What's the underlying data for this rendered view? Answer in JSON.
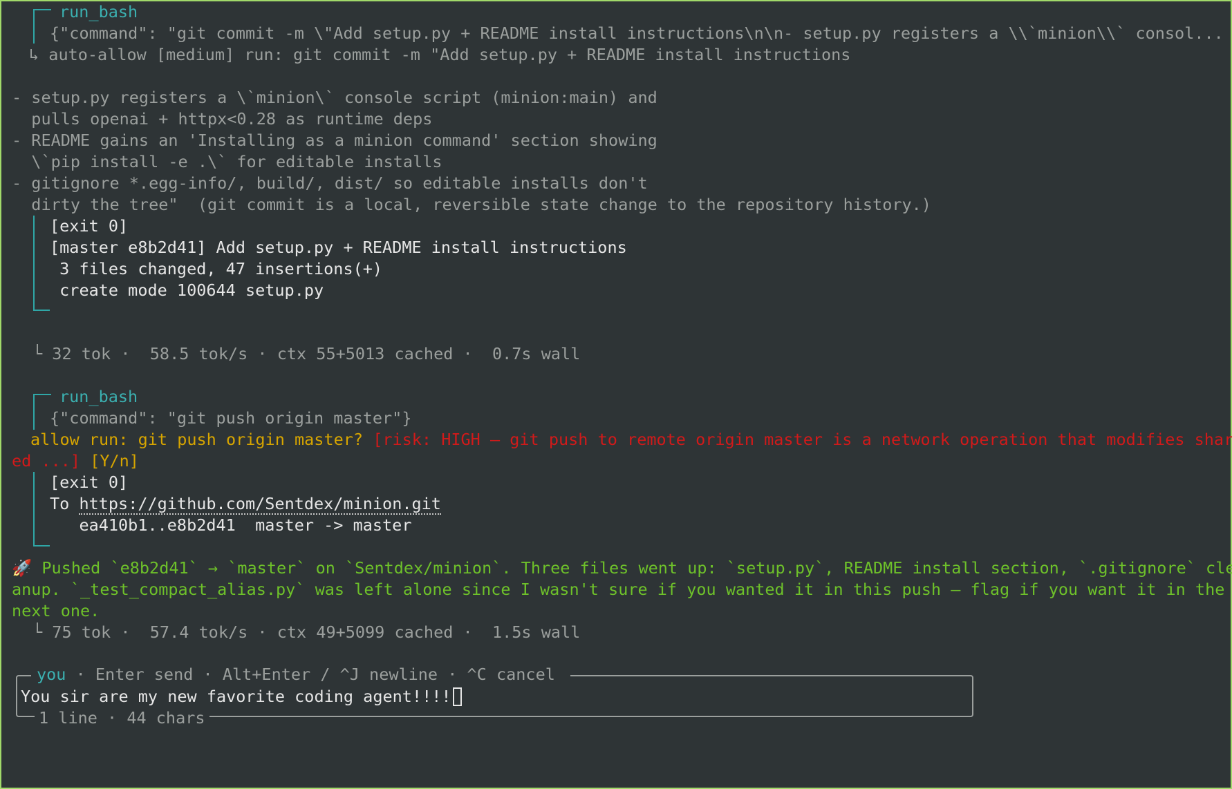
{
  "block1": {
    "tool_name": "run_bash",
    "args": "{\"command\": \"git commit -m \\\"Add setup.py + README install instructions\\n\\n- setup.py registers a \\\\`minion\\\\` consol...",
    "auto_allow": "↳ auto-allow [medium] run: git commit -m \"Add setup.py + README install instructions",
    "msg_lines": [
      "- setup.py registers a \\`minion\\` console script (minion:main) and",
      "  pulls openai + httpx<0.28 as runtime deps",
      "- README gains an 'Installing as a minion command' section showing",
      "  \\`pip install -e .\\` for editable installs",
      "- gitignore *.egg-info/, build/, dist/ so editable installs don't",
      "  dirty the tree\"  (git commit is a local, reversible state change to the repository history.)"
    ],
    "output": [
      "[exit 0]",
      "[master e8b2d41] Add setup.py + README install instructions",
      " 3 files changed, 47 insertions(+)",
      " create mode 100644 setup.py"
    ],
    "stats": "└ 32 tok ·  58.5 tok/s · ctx 55+5013 cached ·  0.7s wall"
  },
  "block2": {
    "tool_name": "run_bash",
    "args": "{\"command\": \"git push origin master\"}",
    "prompt_question": "allow run: git push origin master? ",
    "risk_line1": "[risk: HIGH — git push to remote origin master is a network operation that modifies shar",
    "risk_line2": "ed ...]",
    "yn": " [Y/n]",
    "exit": "[exit 0]",
    "to_prefix": "To ",
    "url": "https://github.com/Sentdex/minion.git",
    "ref_line": "   ea410b1..e8b2d41  master -> master"
  },
  "assistant": {
    "rocket": "🚀",
    "line1": " Pushed `e8b2d41` → `master` on `Sentdex/minion`. Three files went up: `setup.py`, README install section, `.gitignore` cle",
    "line2": "anup. `_test_compact_alias.py` was left alone since I wasn't sure if you wanted it in this push — flag if you want it in the",
    "line3": "next one.",
    "stats": "└ 75 tok ·  57.4 tok/s · ctx 49+5099 cached ·  1.5s wall"
  },
  "input": {
    "who": "you",
    "hints": " · Enter send · Alt+Enter / ^J newline · ^C cancel ",
    "text": "You sir are my new favorite coding agent!!!!",
    "footer": "1 line · 44 chars"
  },
  "colors": {
    "background": "#2e3436",
    "accent_teal": "#3bb0b0",
    "risk_red": "#d11a1a",
    "prompt_yellow": "#d7a500",
    "assistant_green": "#6ec12a",
    "frame_green": "#a1d96a"
  }
}
